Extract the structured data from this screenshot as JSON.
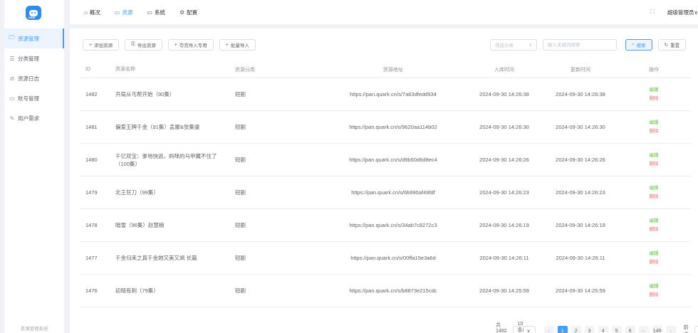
{
  "sidebar": {
    "logo_text": "DBM",
    "items": [
      {
        "label": "资源管理",
        "icon": "folder-icon",
        "glyph": "🗁",
        "active": true
      },
      {
        "label": "分类管理",
        "icon": "sliders-icon",
        "glyph": "☰"
      },
      {
        "label": "资源日志",
        "icon": "compass-icon",
        "glyph": "⊘"
      },
      {
        "label": "账号管理",
        "icon": "monitor-icon",
        "glyph": "▭"
      },
      {
        "label": "用户需求",
        "icon": "edit-icon",
        "glyph": "✎"
      }
    ],
    "footer": "资源管理系统"
  },
  "header": {
    "tabs": [
      {
        "label": "概况",
        "glyph": "⌂"
      },
      {
        "label": "资源",
        "glyph": "▭",
        "active": true
      },
      {
        "label": "系统",
        "glyph": "▭"
      },
      {
        "label": "配置",
        "glyph": "⚙"
      }
    ],
    "user": "超级管理员∨"
  },
  "toolbar": {
    "add": "添加资源",
    "export": "导出资源",
    "quark_import": "夸克导入专用",
    "batch_import": "批量导入"
  },
  "filters": {
    "category_placeholder": "筛选分类",
    "keyword_placeholder": "输入关键词搜索",
    "search": "搜索",
    "reset": "重置"
  },
  "table": {
    "headers": {
      "id": "ID",
      "name": "资源名称",
      "category": "资源分类",
      "url": "资源地址",
      "created": "入库时间",
      "updated": "更新时间",
      "actions": "操作"
    },
    "edit_label": "编辑",
    "delete_label": "删除",
    "rows": [
      {
        "id": "1482",
        "name": "开局从丐帮开始（90集）",
        "category": "短剧",
        "url": "https://pan.quark.cn/s/7a63dfedd934",
        "created": "2024-09-30 14:26:38",
        "updated": "2024-09-30 14:26:38"
      },
      {
        "id": "1481",
        "name": "偏爱王牌千金（91集）孟娜&张集骏",
        "category": "短剧",
        "url": "https://pan.quark.cn/s/9620aa114b02",
        "created": "2024-09-30 14:26:30",
        "updated": "2024-09-30 14:26:30"
      },
      {
        "id": "1480",
        "name": "千亿双宝：爹地快逃，妈咪的马甲藏不住了（100集）",
        "category": "短剧",
        "url": "https://pan.quark.cn/s/d9b60d6d8ec4",
        "created": "2024-09-30 14:26:26",
        "updated": "2024-09-30 14:26:26"
      },
      {
        "id": "1479",
        "name": "北王狂刀（99集）",
        "category": "短剧",
        "url": "https://pan.quark.cn/s/6b990af49fdf",
        "created": "2024-09-30 14:26:23",
        "updated": "2024-09-30 14:26:23"
      },
      {
        "id": "1478",
        "name": "暗雪（96集）赵慧楠",
        "category": "短剧",
        "url": "https://pan.quark.cn/s/34ab7c8272c3",
        "created": "2024-09-30 14:26:19",
        "updated": "2024-09-30 14:26:19"
      },
      {
        "id": "1477",
        "name": "千金归来之真千金她又美又飒 长篇",
        "category": "短剧",
        "url": "https://pan.quark.cn/s/00ffa15e3a6d",
        "created": "2024-09-30 14:26:11",
        "updated": "2024-09-30 14:26:11"
      },
      {
        "id": "1476",
        "name": "初晴有刺（79集）",
        "category": "短剧",
        "url": "https://pan.quark.cn/s/b8873e215cdc",
        "created": "2024-09-30 14:25:59",
        "updated": "2024-09-30 14:25:59"
      }
    ]
  },
  "pagination": {
    "total": "共 1482 条",
    "page_size": "10条/页",
    "pages": [
      "1",
      "2",
      "3",
      "4",
      "5",
      "6",
      "···",
      "149"
    ],
    "current": "1",
    "goto_label": "前往",
    "goto_value": "1"
  },
  "colors": {
    "accent": "#409eff",
    "edit": "#67c23a",
    "delete": "#f56c6c"
  }
}
